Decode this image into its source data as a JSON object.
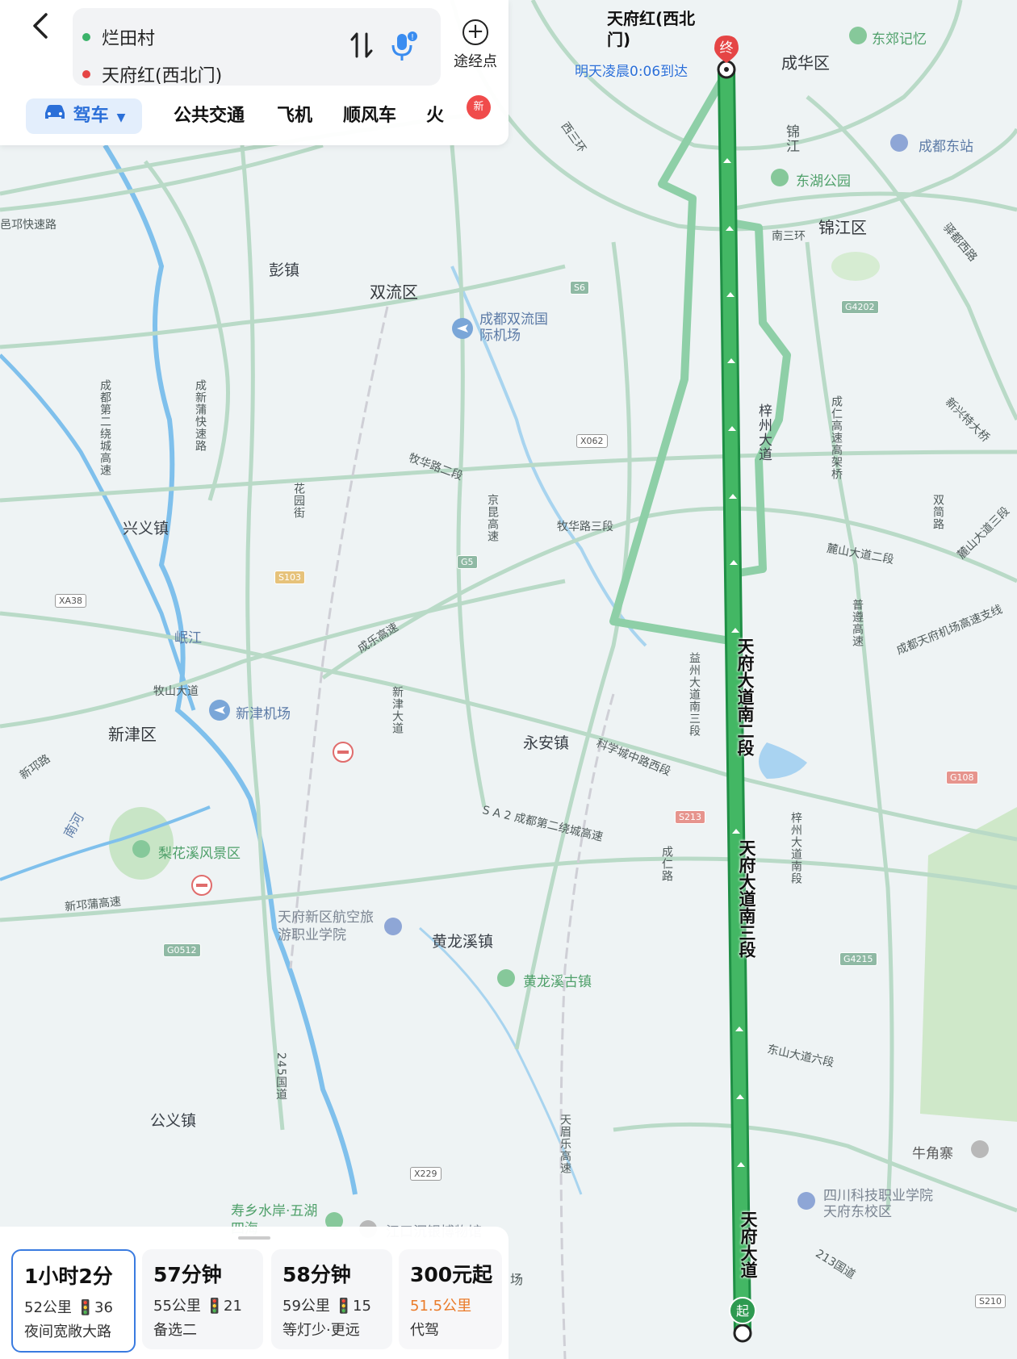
{
  "header": {
    "start_point": "烂田村",
    "end_point": "天府红(西北门)",
    "waypoint_label": "途经点",
    "start_color": "#3bb36a",
    "end_color": "#e54545"
  },
  "modes": {
    "drive": "驾车",
    "transit": "公共交通",
    "plane": "飞机",
    "carpool": "顺风车",
    "train": "火",
    "new_badge": "新"
  },
  "destination": {
    "name": "天府红(西北门)",
    "arrival": "明天凌晨0:06到达",
    "end_marker": "终",
    "start_marker": "起"
  },
  "route_cards": [
    {
      "time": "1小时2分",
      "detail": "52公里 🚦36",
      "note": "夜间宽敞大路",
      "selected": true
    },
    {
      "time": "57分钟",
      "detail": "55公里 🚦21",
      "note": "备选二",
      "selected": false
    },
    {
      "time": "58分钟",
      "detail": "59公里 🚦15",
      "note": "等灯少·更远",
      "selected": false
    },
    {
      "time": "300元起",
      "detail": "51.5公里",
      "note": "代驾",
      "selected": false
    }
  ],
  "map_labels": {
    "chenghua": "成华区",
    "dongjiao": "东郊记忆",
    "jinjiang_small": "锦江",
    "chengdu_east": "成都东站",
    "donghu": "东湖公园",
    "jinjiang": "锦江区",
    "nansanhuan": "南三环",
    "xisanhuan": "西三环",
    "pengzhen": "彭镇",
    "shuangliu": "双流区",
    "airport": "成都双流国际机场",
    "qionglai": "邑邛快速路",
    "ring2": "成都第二绕城高速",
    "pujiang": "成新蒲快速路",
    "xingyi": "兴义镇",
    "minjiang": "岷江",
    "muhua2": "牧华路二段",
    "muhua3": "牧华路三段",
    "jingkun": "京昆高速",
    "huayuan": "花园街",
    "zizhou": "梓州大道",
    "chengren": "成仁高速高架桥",
    "shuangjian": "双简路",
    "longshan2": "麓山大道二段",
    "longshan3": "麓山大道三段",
    "xinxing": "新兴特大桥",
    "pudan": "普遵高速",
    "airport_branch": "成都天府机场高速支线",
    "chengle": "成乐高速",
    "xinjin_ave": "新津大道",
    "yizhou": "益州大道南三段",
    "tianfu_south2": "天府大道南二段",
    "tianfu_south3": "天府大道南三段",
    "tianfu": "天府大道",
    "mushan": "牧山大道",
    "xinjin_airport": "新津机场",
    "xinjin": "新津区",
    "xinqiong": "新邛路",
    "nanhe": "南河",
    "yongan": "永安镇",
    "kexuecheng": "科学城中路西段",
    "sa2": "S A 2 成都第二绕城高速",
    "chengren_rd": "成仁路",
    "zizhou_south": "梓州大道南段",
    "lihuaxi": "梨花溪风景区",
    "xinqiong_exp": "新邛蒲高速",
    "tianfu_college": "天府新区航空旅游职业学院",
    "huanglongxi": "黄龙溪镇",
    "huanglongxi_old": "黄龙溪古镇",
    "dongshan6": "东山大道六段",
    "gongyi": "公义镇",
    "g245": "245国道",
    "tianmeile": "天眉乐高速",
    "shouxiang": "寿乡水岸·五湖四海",
    "jiangkou": "江口沉银博物馆",
    "niujiao": "牛角寨",
    "sichuan_tech": "四川科技职业学院天府东校区",
    "g213": "213国道",
    "yudu": "驿都西路",
    "chang": "场"
  },
  "shields": {
    "s6": "S6",
    "g4202": "G4202",
    "x062": "X062",
    "g5": "G5",
    "s103": "S103",
    "xa38": "XA38",
    "g108": "G108",
    "s213": "S213",
    "g4215": "G4215",
    "g0512": "G0512",
    "x229": "X229",
    "s210": "S210"
  }
}
